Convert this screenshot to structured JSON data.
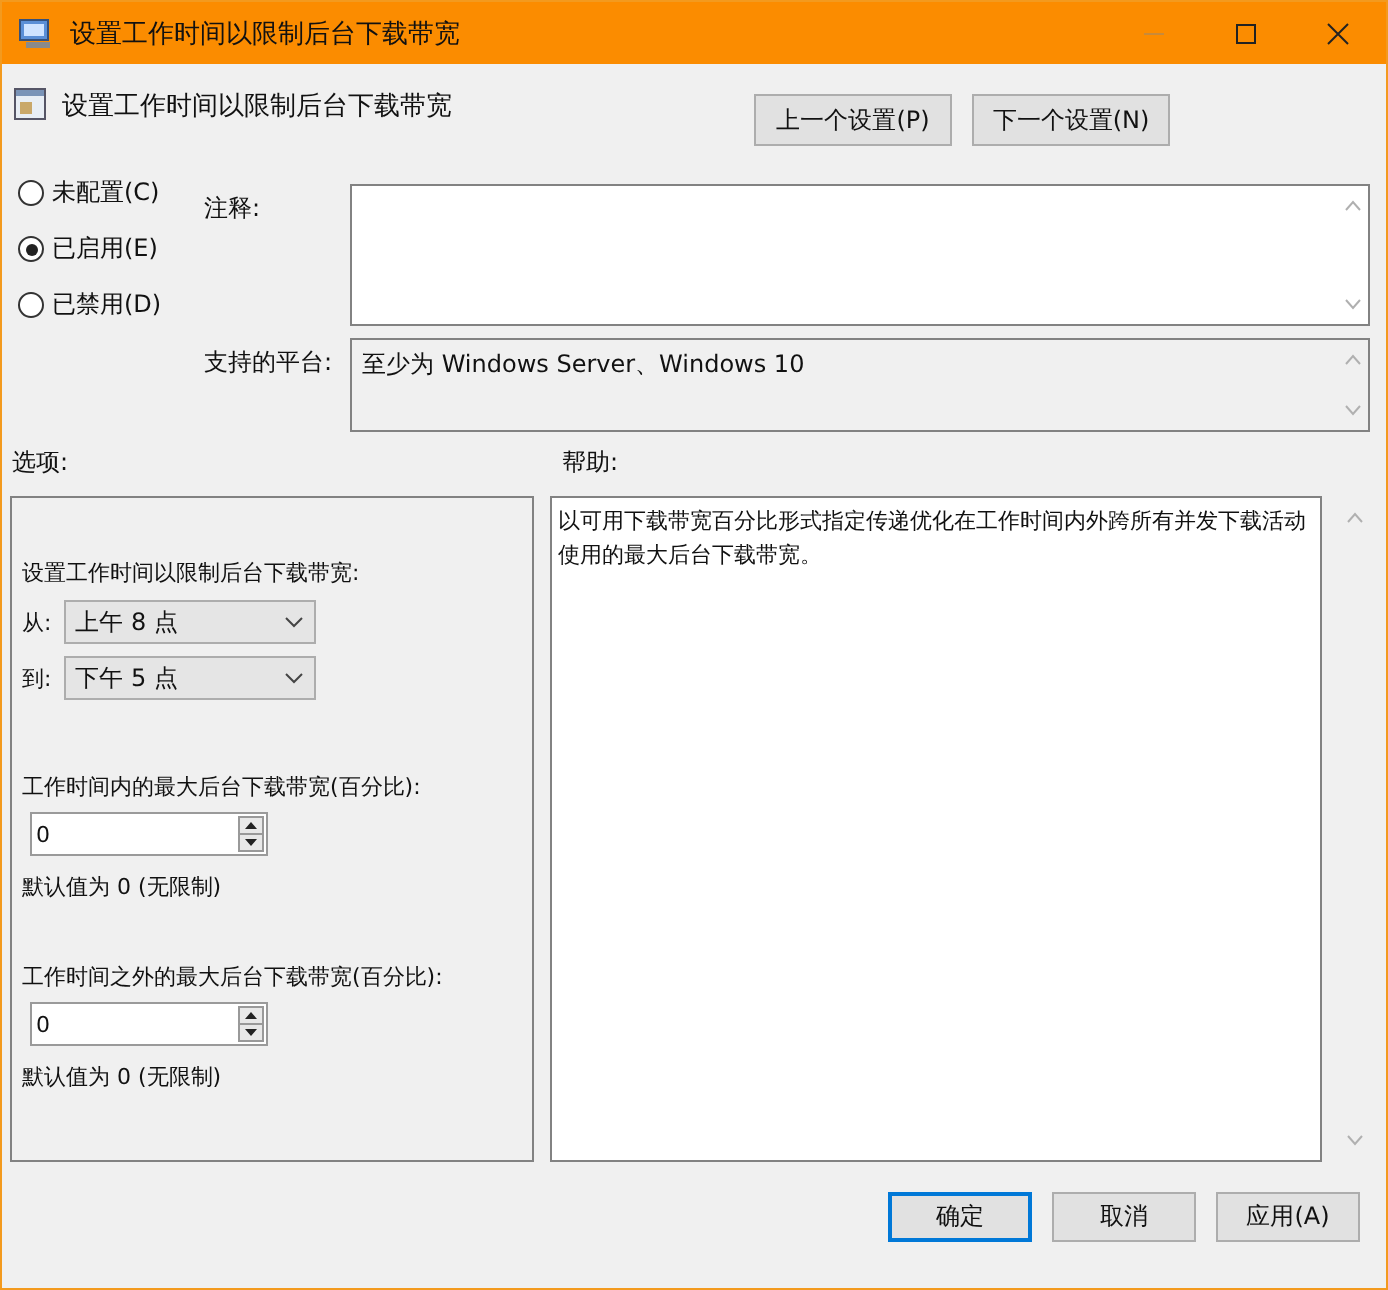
{
  "window": {
    "title": "设置工作时间以限制后台下载带宽"
  },
  "header": {
    "title": "设置工作时间以限制后台下载带宽",
    "buttons": [
      "上一个设置(P)",
      "下一个设置(N)"
    ]
  },
  "states": [
    {
      "label": "未配置(C)",
      "selected": false
    },
    {
      "label": "已启用(E)",
      "selected": true
    },
    {
      "label": "已禁用(D)",
      "selected": false
    }
  ],
  "comment": {
    "label": "注释:"
  },
  "platform": {
    "label": "支持的平台:",
    "value": "至少为 Windows Server、Windows 10"
  },
  "options": {
    "label": "选项:",
    "items": [
      {
        "kind": "heading",
        "text": "设置工作时间以限制后台下载带宽:"
      },
      {
        "kind": "dropdown",
        "label": "从:",
        "value": "上午 8 点"
      },
      {
        "kind": "dropdown",
        "label": "到:",
        "value": "下午 5 点"
      },
      {
        "kind": "number",
        "label": "工作时间内的最大后台下载带宽(百分比):",
        "value": "0"
      },
      {
        "kind": "note",
        "text": "默认值为 0 (无限制)"
      },
      {
        "kind": "number",
        "label": "工作时间之外的最大后台下载带宽(百分比):",
        "value": "0"
      },
      {
        "kind": "note",
        "text": "默认值为 0 (无限制)"
      }
    ]
  },
  "help": {
    "label": "帮助:",
    "text": "以可用下载带宽百分比形式指定传递优化在工作时间内外跨所有并发下载活动使用的最大后台下载带宽。"
  },
  "buttons": [
    {
      "label": "确定",
      "default": true
    },
    {
      "label": "取消",
      "default": false
    },
    {
      "label": "应用(A)",
      "default": false
    }
  ]
}
